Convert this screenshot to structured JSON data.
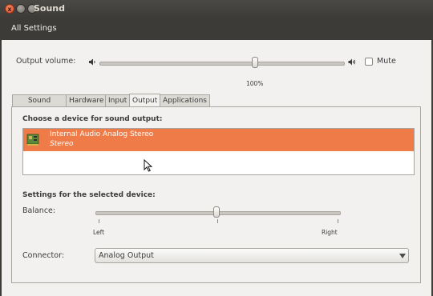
{
  "window": {
    "title": "Sound",
    "close_glyph": "x",
    "min_glyph": "–",
    "max_glyph": "+"
  },
  "toolbar": {
    "all_settings_label": "All Settings"
  },
  "output_volume": {
    "label": "Output volume:",
    "value_text": "100%",
    "level": 0.63,
    "mute_label": "Mute",
    "mute_checked": false,
    "icons": [
      "speaker-low-icon",
      "speaker-high-icon"
    ]
  },
  "tabs": [
    {
      "label": "Sound Effects",
      "active": false
    },
    {
      "label": "Hardware",
      "active": false
    },
    {
      "label": "Input",
      "active": false
    },
    {
      "label": "Output",
      "active": true
    },
    {
      "label": "Applications",
      "active": false
    }
  ],
  "output_panel": {
    "device_heading": "Choose a device for sound output:",
    "devices": [
      {
        "name": "Internal Audio Analog Stereo",
        "subtitle": "Stereo",
        "selected": true,
        "icon": "sound-card-icon"
      }
    ],
    "settings_heading": "Settings for the selected device:",
    "balance": {
      "label": "Balance:",
      "left_label": "Left",
      "right_label": "Right",
      "value": 0.5
    },
    "connector": {
      "label": "Connector:",
      "value": "Analog Output"
    }
  },
  "colors": {
    "selection": "#ef7c48",
    "titlebar": "#3c3b37",
    "window_bg": "#f2f1f0",
    "close_button": "#e0502a"
  }
}
